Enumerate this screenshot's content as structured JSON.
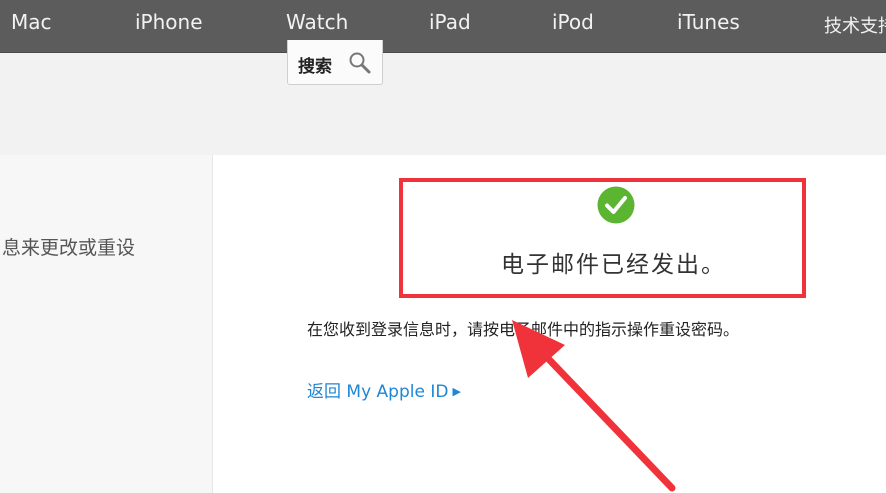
{
  "nav": {
    "items": [
      "Mac",
      "iPhone",
      "Watch",
      "iPad",
      "iPod",
      "iTunes",
      "技术支持"
    ]
  },
  "search": {
    "label": "搜索",
    "icon": "magnifier-icon"
  },
  "sidebar": {
    "text": "息来更改或重设"
  },
  "main": {
    "status_icon": "checkmark-icon",
    "status_color": "#5cb531",
    "sent_message": "电子邮件已经发出。",
    "instruction": "在您收到登录信息时，请按电子邮件中的指示操作重设密码。",
    "back_link": "返回 My Apple ID",
    "back_link_icon": "caret-right-icon"
  },
  "annotation": {
    "highlight_color": "#f0333a"
  }
}
